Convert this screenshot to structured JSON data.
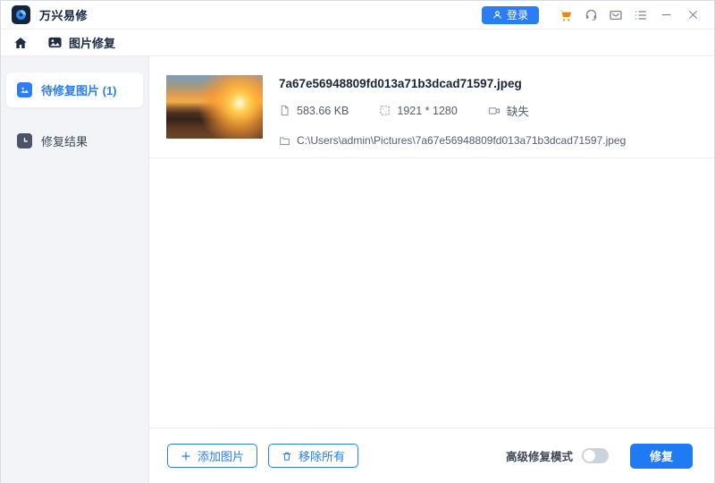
{
  "app": {
    "title": "万兴易修"
  },
  "titlebar": {
    "login_label": "登录",
    "icon_names": [
      "cart-icon",
      "support-headset-icon",
      "mail-icon",
      "menu-list-icon",
      "minimize-icon",
      "close-icon"
    ]
  },
  "navbar": {
    "tab_label": "图片修复"
  },
  "sidebar": {
    "items": [
      {
        "label": "待修复图片 (1)",
        "active": true
      },
      {
        "label": "修复结果",
        "active": false
      }
    ]
  },
  "file": {
    "name": "7a67e56948809fd013a71b3dcad71597.jpeg",
    "size": "583.66 KB",
    "dimensions": "1921 * 1280",
    "status": "缺失",
    "path": "C:\\Users\\admin\\Pictures\\7a67e56948809fd013a71b3dcad71597.jpeg"
  },
  "footer": {
    "add_label": "添加图片",
    "remove_label": "移除所有",
    "advanced_mode_label": "高级修复模式",
    "advanced_mode_on": false,
    "repair_label": "修复"
  },
  "colors": {
    "accent_blue": "#2a7df2",
    "cart_orange": "#f5820c",
    "dark_navy": "#16233f",
    "sidebar_bg": "#f2f4f8"
  }
}
